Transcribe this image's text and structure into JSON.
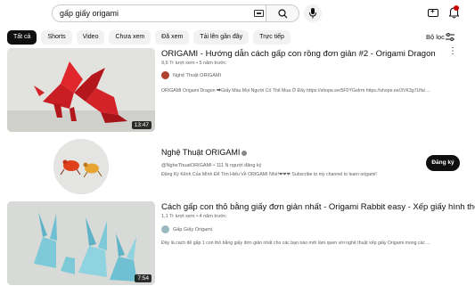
{
  "search": {
    "query": "gấp giấy origami"
  },
  "chips": [
    "Tất cả",
    "Shorts",
    "Video",
    "Chưa xem",
    "Đã xem",
    "Tải lên gần đây",
    "Trực tiếp"
  ],
  "filter_label": "Bộ lọc",
  "results": [
    {
      "title": "ORIGAMI - Hướng dẫn cách gấp con rồng đơn giản #2 - Origami Dragon",
      "meta": "9,6 Tr lượt xem • 5 năm trước",
      "channel": "Nghệ Thuật ORIGAMI",
      "desc": "ORIGAMI Origami Dragon ⮕Giấy Màu Mọi Người Có Thể Mua Ở Đây https://shope.ee/5F0YGeIrm https://shope.ee/3VK3g7Ufai ...",
      "duration": "13:47"
    },
    {
      "channel_name": "Nghệ Thuật ORIGAMI",
      "handle_line": "@NgheThuatORIGAMI • 111 N người đăng ký",
      "desc": "Đăng Ký Kênh Của Mình Để Tìm Hiểu Về ORIGAMI Nhé!❤❤❤ Subscribe to my channel to learn origami!",
      "subscribe": "Đăng ký"
    },
    {
      "title": "Cách gấp con thỏ bằng giấy đơn giản nhất - Origami Rabbit easy - Xếp giấy hình thỏ",
      "meta": "1,1 Tr lượt xem • 4 năm trước",
      "channel": "Gấp Giấy Origami",
      "desc": "Đây là cách để gấp 1 con thỏ bằng giấy đơn giản nhất cho các bạn nào mới làm quen với nghệ thuật xếp giấy Origami mong các ...",
      "duration": "7:54"
    }
  ],
  "colors": {
    "subscribe_bg": "#0f0f0f",
    "notification_badge": "#cc0000",
    "dragon": "#d21f24",
    "rabbit": "#7ec9d8"
  }
}
